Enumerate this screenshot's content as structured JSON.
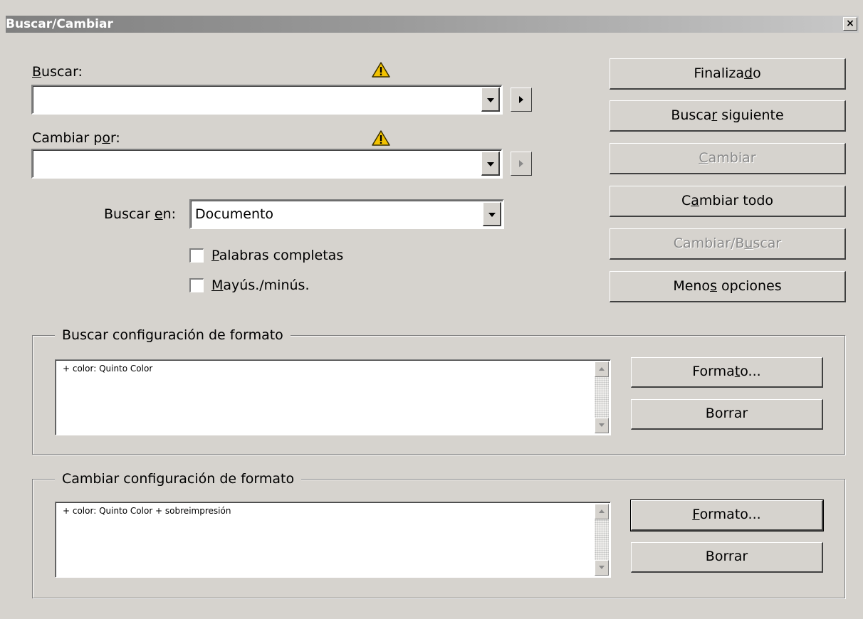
{
  "window": {
    "title": "Buscar/Cambiar",
    "close_glyph": "×"
  },
  "find": {
    "label": "Buscar:",
    "value": "",
    "warning_icon": "warning-icon"
  },
  "replace": {
    "label": "Cambiar por:",
    "value": "",
    "warning_icon": "warning-icon"
  },
  "search_in": {
    "label": "Buscar en:",
    "selected": "Documento"
  },
  "options": {
    "whole_words": {
      "label": "Palabras completas",
      "checked": false
    },
    "match_case": {
      "label": "Mayús./minús.",
      "checked": false
    }
  },
  "buttons": {
    "done": {
      "label": "Finalizado",
      "enabled": true
    },
    "find_next": {
      "label": "Buscar siguiente",
      "enabled": true
    },
    "change": {
      "label": "Cambiar",
      "enabled": false
    },
    "change_all": {
      "label": "Cambiar todo",
      "enabled": true
    },
    "change_find": {
      "label": "Cambiar/Buscar",
      "enabled": false
    },
    "fewer_options": {
      "label": "Menos opciones",
      "enabled": true
    }
  },
  "find_format": {
    "legend": "Buscar configuración de formato",
    "value": "+ color:  Quinto Color",
    "format_button": "Formato...",
    "clear_button": "Borrar"
  },
  "change_format": {
    "legend": "Cambiar configuración de formato",
    "value": "+ color:  Quinto Color + sobreimpresión",
    "format_button": "Formato...",
    "clear_button": "Borrar"
  },
  "colors": {
    "dialog_bg": "#d6d3ce",
    "warning": "#f2c200",
    "disabled_text": "#8a8a8a"
  }
}
